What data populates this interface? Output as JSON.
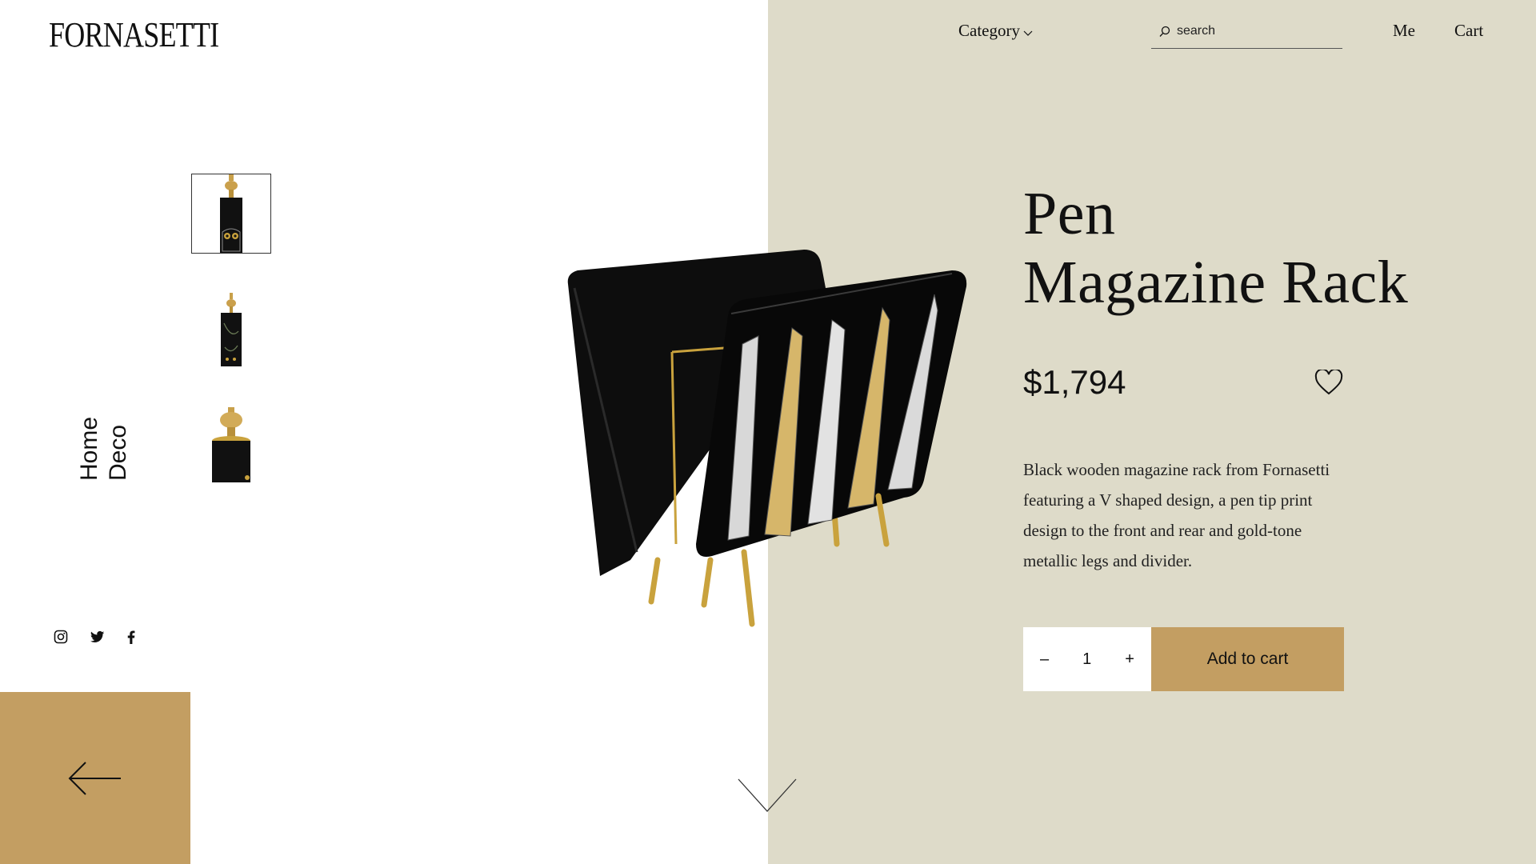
{
  "brand": {
    "logo_text": "FORNASETTI"
  },
  "nav": {
    "category_label": "Category",
    "search_placeholder": "search",
    "me_label": "Me",
    "cart_label": "Cart"
  },
  "sidebar": {
    "category_line1": "Home",
    "category_line2": "Deco",
    "social_icons": [
      "instagram-icon",
      "twitter-icon",
      "facebook-icon"
    ]
  },
  "product": {
    "title_line1": "Pen",
    "title_line2": "Magazine Rack",
    "price": "$1,794",
    "description": "Black wooden magazine rack from Fornasetti featuring a V shaped design, a pen tip print design to the front and rear and gold-tone metallic legs and divider.",
    "quantity": "1",
    "qty_minus": "–",
    "qty_plus": "+",
    "add_to_cart_label": "Add to cart"
  },
  "colors": {
    "right_panel": "#dedbc9",
    "accent_gold": "#c39e62",
    "text": "#111111"
  }
}
